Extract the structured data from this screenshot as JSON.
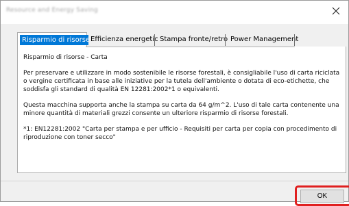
{
  "window": {
    "title": "Resource and Energy Saving"
  },
  "tabs": [
    {
      "label": "Risparmio di risorse",
      "active": true
    },
    {
      "label": "Efficienza energetica",
      "active": false
    },
    {
      "label": "Stampa fronte/retro",
      "active": false
    },
    {
      "label": "Power Management",
      "active": false
    }
  ],
  "content": {
    "heading": "Risparmio di risorse - Carta",
    "paragraph1": "Per preservare e utilizzare in modo sostenibile le risorse forestali, è consigliabile l'uso di carta riciclata o vergine certificata in base alle iniziative per la tutela dell'ambiente o dotata di eco-etichette, che soddisfa gli standard di qualità EN 12281:2002*1 o equivalenti.",
    "paragraph2": "Questa macchina supporta anche la stampa su carta da 64 g/m^2. L'uso di tale carta contenente una minore quantità di materiali grezzi consente un ulteriore risparmio di risorse forestali.",
    "footnote": "*1: EN12281:2002 \"Carta per stampa e per ufficio - Requisiti per carta per copia con procedimento di riproduzione con toner secco\""
  },
  "buttons": {
    "ok_label": "OK"
  },
  "icons": {
    "close": "close-icon"
  },
  "colors": {
    "selection": "#0078d7",
    "highlight": "#e02020"
  }
}
